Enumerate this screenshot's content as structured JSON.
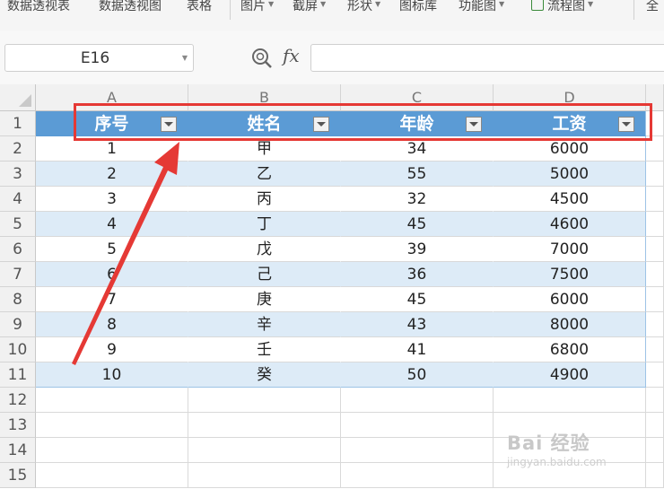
{
  "ribbon": {
    "items": [
      {
        "label": "数据透视表",
        "dropdown": false
      },
      {
        "label": "数据透视图",
        "dropdown": false
      },
      {
        "label": "表格",
        "dropdown": false
      },
      {
        "label": "图片",
        "dropdown": true
      },
      {
        "label": "截屏",
        "dropdown": true
      },
      {
        "label": "形状",
        "dropdown": true
      },
      {
        "label": "图标库",
        "dropdown": false
      },
      {
        "label": "功能图",
        "dropdown": true
      },
      {
        "label": "流程图",
        "dropdown": true
      },
      {
        "label": "全",
        "dropdown": false
      }
    ]
  },
  "formula_bar": {
    "name_box": "E16",
    "fx_label": "fx",
    "formula": ""
  },
  "sheet": {
    "columns": [
      "A",
      "B",
      "C",
      "D"
    ],
    "row_numbers": [
      "1",
      "2",
      "3",
      "4",
      "5",
      "6",
      "7",
      "8",
      "9",
      "10",
      "11",
      "12",
      "13",
      "14",
      "15"
    ],
    "table_headers": [
      "序号",
      "姓名",
      "年龄",
      "工资"
    ],
    "rows": [
      [
        "1",
        "甲",
        "34",
        "6000"
      ],
      [
        "2",
        "乙",
        "55",
        "5000"
      ],
      [
        "3",
        "丙",
        "32",
        "4500"
      ],
      [
        "4",
        "丁",
        "45",
        "4600"
      ],
      [
        "5",
        "戊",
        "39",
        "7000"
      ],
      [
        "6",
        "己",
        "36",
        "7500"
      ],
      [
        "7",
        "庚",
        "45",
        "6000"
      ],
      [
        "8",
        "辛",
        "43",
        "8000"
      ],
      [
        "9",
        "壬",
        "41",
        "6800"
      ],
      [
        "10",
        "癸",
        "50",
        "4900"
      ]
    ]
  },
  "annotations": {
    "highlight_color": "#e53935",
    "header_fill": "#5b9bd5",
    "band_fill": "#ddebf7"
  },
  "watermark": {
    "text": "Bai 经验",
    "subtext": "jingyan.baidu.com"
  }
}
